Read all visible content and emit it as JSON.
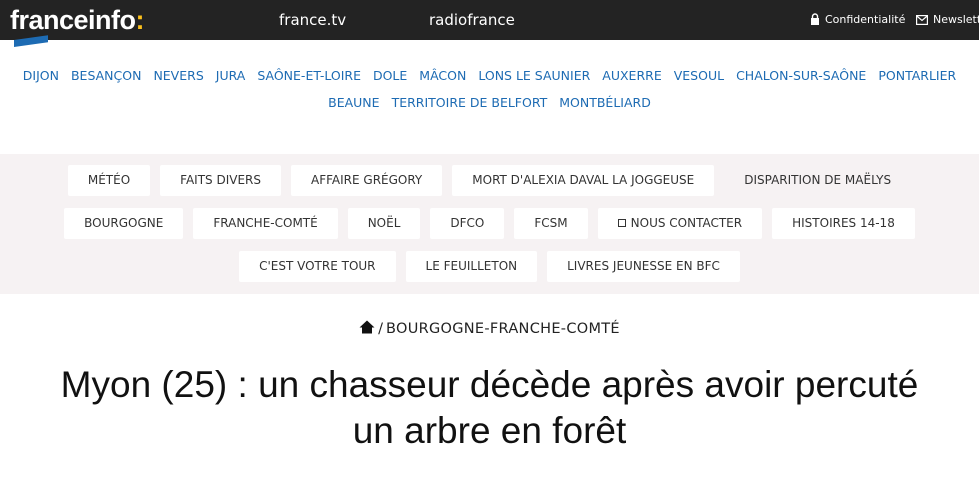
{
  "header": {
    "logo_text": "franceinfo",
    "logo_dot": ":",
    "nav": [
      "france.tv",
      "radiofrance"
    ],
    "privacy_label": "Confidentialité",
    "newsletter_label": "Newsletter"
  },
  "regions": {
    "row1": [
      "DIJON",
      "BESANÇON",
      "NEVERS",
      "JURA",
      "SAÔNE-ET-LOIRE",
      "DOLE",
      "MÂCON",
      "LONS LE SAUNIER",
      "AUXERRE",
      "VESOUL",
      "CHALON-SUR-SAÔNE",
      "PONTARLIER"
    ],
    "row2": [
      "BEAUNE",
      "TERRITOIRE DE BELFORT",
      "MONTBÉLIARD"
    ]
  },
  "tags": {
    "row1": [
      "MÉTÉO",
      "FAITS DIVERS",
      "AFFAIRE GRÉGORY",
      "MORT D'ALEXIA DAVAL LA JOGGEUSE",
      "DISPARITION DE MAËLYS"
    ],
    "row2": [
      "BOURGOGNE",
      "FRANCHE-COMTÉ",
      "NOËL",
      "DFCO",
      "FCSM",
      "NOUS CONTACTER",
      "HISTOIRES 14-18"
    ],
    "row3": [
      "C'EST VOTRE TOUR",
      "LE FEUILLETON",
      "LIVRES JEUNESSE EN BFC"
    ]
  },
  "breadcrumb": {
    "separator": "/",
    "current": "BOURGOGNE-FRANCHE-COMTÉ"
  },
  "article": {
    "title": "Myon (25) : un chasseur décède après avoir percuté un arbre en forêt"
  },
  "colors": {
    "topbar_bg": "#232323",
    "accent_yellow": "#fcc11d",
    "link_blue": "#1d6bb3",
    "tag_area_bg": "#f6f2f3"
  }
}
